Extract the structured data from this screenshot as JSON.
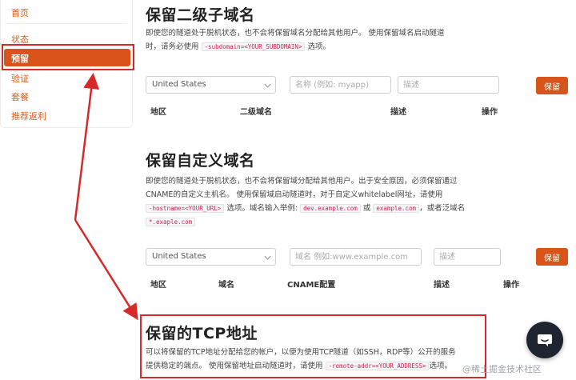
{
  "sidebar": {
    "items": [
      {
        "label": "首页"
      },
      {
        "label": "状态"
      },
      {
        "label": "预留"
      },
      {
        "label": "验证"
      },
      {
        "label": "套餐"
      },
      {
        "label": "推荐返利"
      }
    ],
    "active_index": 2
  },
  "section_subdomain": {
    "title": "保留二级子域名",
    "desc_line1": "即使您的隧道处于脱机状态，也不会将保留域名分配给其他用户。 使用保留域名启动隧道",
    "desc_line2_pre": "时，请务必使用",
    "desc_code": "-subdomain=<YOUR_SUBDOMAIN>",
    "desc_line2_post": "选项。",
    "region_value": "United States",
    "name_placeholder": "名称 (例如: myapp)",
    "desc_placeholder": "描述",
    "reserve_label": "保留",
    "columns": [
      "地区",
      "二级域名",
      "描述",
      "操作"
    ]
  },
  "section_custom": {
    "title": "保留自定义域名",
    "desc_line1": "即使您的隧道处于脱机状态，也不会将保留域分配给其他用户。出于安全原因，必须保留通过",
    "desc_line2": "CNAME的自定义主机名。 使用保留域启动隧道时，对于自定义whitelabel网址，请使用",
    "code_hostname": "-hostname=<YOUR_URL>",
    "desc_line3_a": "选项。域名输入举例:",
    "code_example1": "dev.example.com",
    "desc_or": "或",
    "code_example2": "example.com",
    "desc_wild": "，或者泛域名",
    "code_wildcard": "*.exaple.com",
    "region_value": "United States",
    "domain_placeholder": "域名 例如:www.example.com",
    "desc_placeholder": "描述",
    "reserve_label": "保留",
    "columns": [
      "地区",
      "域名",
      "CNAME配置",
      "描述",
      "操作"
    ]
  },
  "section_tcp": {
    "title": "保留的TCP地址",
    "desc_line1": "可以将保留的TCP地址分配给您的帐户，以便为使用TCP隧道（如SSH，RDP等）公开的服务",
    "desc_line2_pre": "提供稳定的端点。 使用保留地址启动隧道时，请使用",
    "desc_code": "-remote-addr=<YOUR_ADDRESS>",
    "desc_line2_post": "选项。"
  },
  "watermark": "@稀土掘金技术社区",
  "colors": {
    "accent": "#d9541a",
    "highlight": "#d62a2a",
    "chat_bg": "#1e2530"
  },
  "icons": {
    "chat": "chat-bubble-icon",
    "dropdown": "chevron-down-icon"
  }
}
